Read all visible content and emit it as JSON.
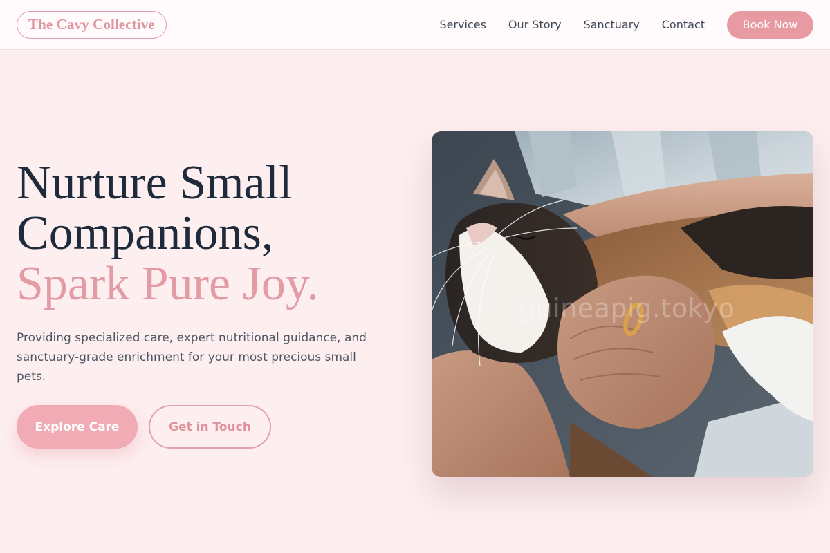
{
  "header": {
    "logo": "The Cavy Collective",
    "nav": [
      "Services",
      "Our Story",
      "Sanctuary",
      "Contact"
    ],
    "cta": "Book Now"
  },
  "hero": {
    "headline_line1": "Nurture Small",
    "headline_line2": "Companions,",
    "headline_accent": "Spark Pure Joy.",
    "subtext": "Providing specialized care, expert nutritional guidance, and sanctuary-grade enrichment for your most precious small pets.",
    "primary_button": "Explore Care",
    "secondary_button": "Get in Touch"
  },
  "photo": {
    "watermark": "guineapig.tokyo"
  },
  "colors": {
    "accent": "#e89aa3",
    "background": "#fdeef0",
    "heading": "#1f2a3a"
  }
}
